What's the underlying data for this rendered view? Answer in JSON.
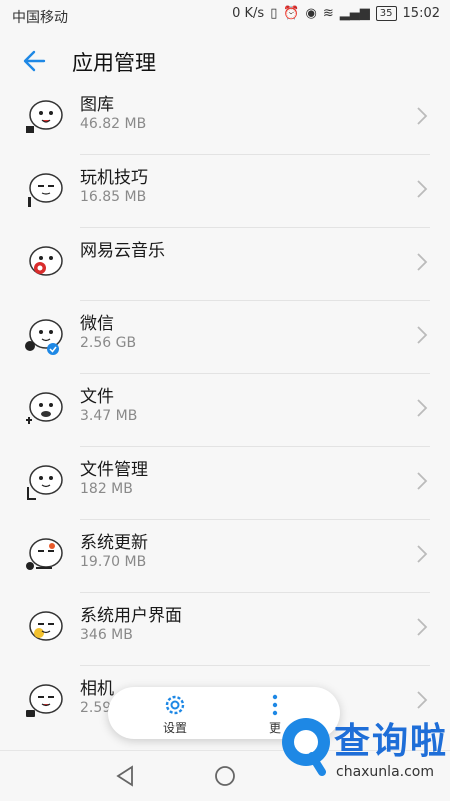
{
  "status_bar": {
    "carrier": "中国移动",
    "speed": "0 K/s",
    "battery": "35",
    "time": "15:02",
    "icons": [
      "vibrate-icon",
      "alarm-icon",
      "eye-icon",
      "wifi-icon",
      "signal-4g-icon",
      "battery-icon"
    ]
  },
  "header": {
    "title": "应用管理",
    "back_icon": "back-arrow-icon"
  },
  "apps": [
    {
      "name": "图库",
      "size": "46.82 MB"
    },
    {
      "name": "玩机技巧",
      "size": "16.85 MB"
    },
    {
      "name": "网易云音乐",
      "size": ""
    },
    {
      "name": "微信",
      "size": "2.56 GB"
    },
    {
      "name": "文件",
      "size": "3.47 MB"
    },
    {
      "name": "文件管理",
      "size": "182 MB"
    },
    {
      "name": "系统更新",
      "size": "19.70 MB"
    },
    {
      "name": "系统用户界面",
      "size": "346 MB"
    },
    {
      "name": "相机",
      "size": "2.59 MB"
    }
  ],
  "floating_bar": {
    "settings_label": "设置",
    "more_label": "更"
  },
  "watermark": {
    "text": "查询啦",
    "url": "chaxunla.com"
  },
  "colors": {
    "accent": "#1e88e5",
    "watermark": "#1e6ed8"
  }
}
